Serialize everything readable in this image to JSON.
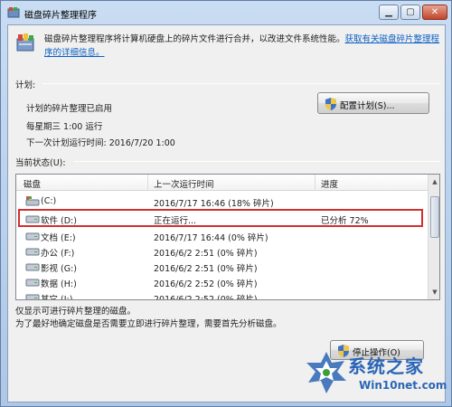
{
  "window": {
    "title": "磁盘碎片整理程序",
    "controls": {
      "minimize": "▁",
      "maximize": "▢",
      "close": "✕"
    }
  },
  "description": {
    "text": "磁盘碎片整理程序将计算机硬盘上的碎片文件进行合并，以改进文件系统性能。",
    "link": "获取有关磁盘碎片整理程序的详细信息。"
  },
  "schedule": {
    "section_label": "计划:",
    "status": "计划的碎片整理已启用",
    "frequency": "每星期三  1:00 运行",
    "next_run": "下一次计划运行时间: 2016/7/20 1:00",
    "configure_button": "配置计划(S)..."
  },
  "current_status": {
    "section_label": "当前状态(U):",
    "columns": [
      "磁盘",
      "上一次运行时间",
      "进度"
    ],
    "rows": [
      {
        "disk": "(C:)",
        "last_run": "2016/7/17 16:46 (18% 碎片)",
        "progress": "",
        "icon": "system-drive-icon"
      },
      {
        "disk": "软件 (D:)",
        "last_run": "正在运行...",
        "progress": "已分析 72%",
        "icon": "drive-icon"
      },
      {
        "disk": "文档 (E:)",
        "last_run": "2016/7/17 16:44 (0% 碎片)",
        "progress": "",
        "icon": "drive-icon"
      },
      {
        "disk": "办公 (F:)",
        "last_run": "2016/6/2 2:51 (0% 碎片)",
        "progress": "",
        "icon": "drive-icon"
      },
      {
        "disk": "影视 (G:)",
        "last_run": "2016/6/2 2:51 (0% 碎片)",
        "progress": "",
        "icon": "drive-icon"
      },
      {
        "disk": "数据 (H:)",
        "last_run": "2016/6/2 2:52 (0% 碎片)",
        "progress": "",
        "icon": "drive-icon"
      },
      {
        "disk": "其它 (I:)",
        "last_run": "2016/6/2 2:52 (0% 碎片)",
        "progress": "",
        "icon": "drive-icon"
      }
    ]
  },
  "notes": {
    "line1": "仅显示可进行碎片整理的磁盘。",
    "line2": "为了最好地确定磁盘是否需要立即进行碎片整理，需要首先分析磁盘。"
  },
  "stop_button": "停止操作(O)",
  "watermark": {
    "name": "系统之家",
    "url": "Win10net.com"
  },
  "colors": {
    "highlight": "#d32f2f",
    "link": "#0b5fc3",
    "watermark": "#2b65b5"
  }
}
